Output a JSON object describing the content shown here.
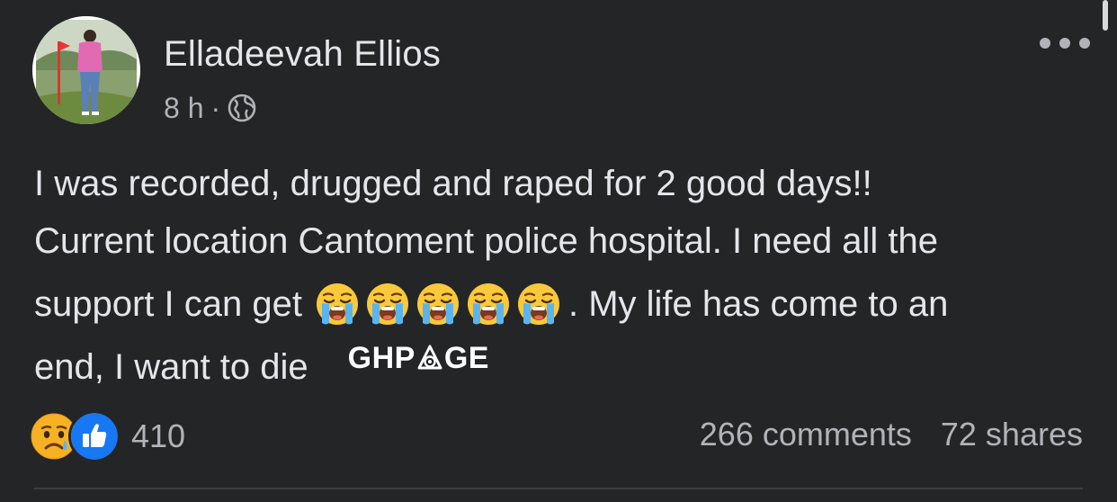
{
  "post": {
    "author": "Elladeevah Ellios",
    "time": "8 h",
    "separator": "·",
    "audience_icon": "globe-icon",
    "more_icon": "more-options-icon",
    "text": {
      "line1": "I was recorded, drugged and raped for 2 good days!!",
      "line2": "Current location Cantoment police hospital. I need all the",
      "line3_before": "support I can get",
      "line3_after": ".  My life has come to an",
      "line4": "end, I want to die"
    },
    "emojis": [
      "loudly-crying-face",
      "loudly-crying-face",
      "loudly-crying-face",
      "loudly-crying-face",
      "loudly-crying-face"
    ],
    "watermark": {
      "before": "GHP",
      "after": "GE",
      "logo_icon": "ghpage-logo-icon"
    },
    "reactions": {
      "icons": [
        "sad-reaction-icon",
        "like-reaction-icon"
      ],
      "count": "410"
    },
    "comments": "266 comments",
    "shares": "72 shares"
  },
  "colors": {
    "background": "#242526",
    "primary_text": "#e4e6eb",
    "secondary_text": "#b0b3b8",
    "like_blue": "#1877f2",
    "sad_yellow": "#f7b125"
  }
}
